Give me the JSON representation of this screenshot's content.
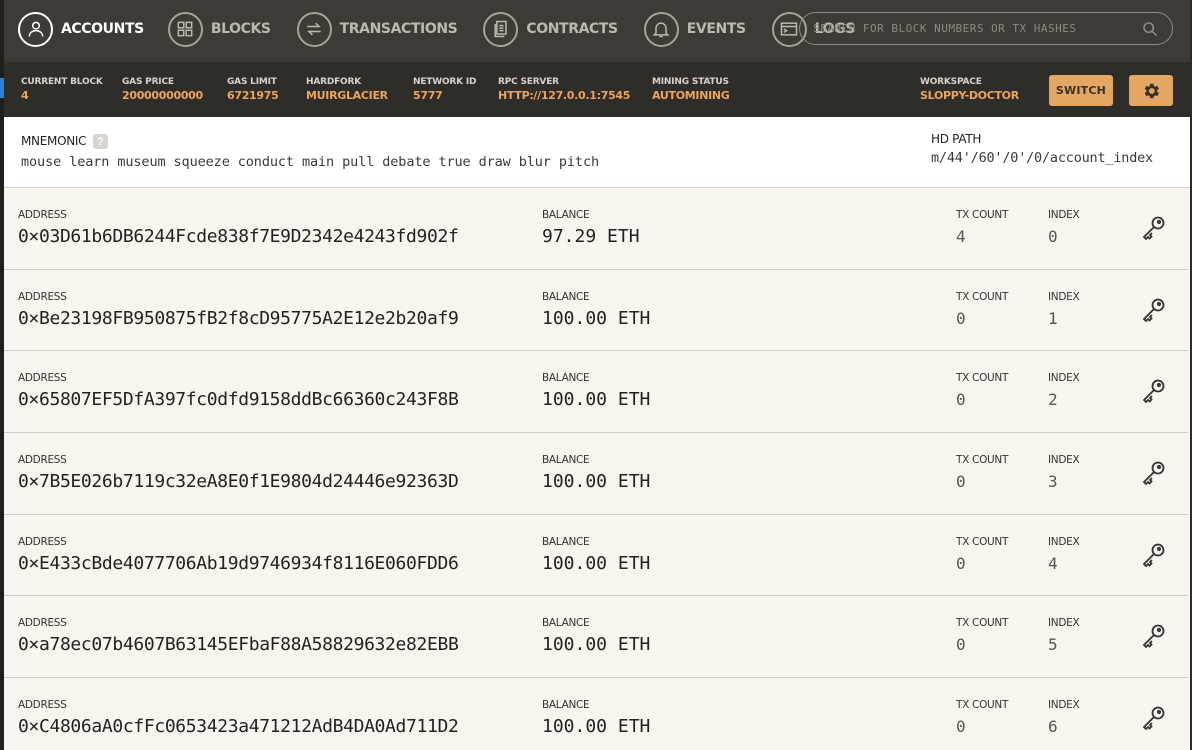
{
  "nav": {
    "items": [
      {
        "label": "ACCOUNTS",
        "icon": "account-icon",
        "active": true
      },
      {
        "label": "BLOCKS",
        "icon": "blocks-icon",
        "active": false
      },
      {
        "label": "TRANSACTIONS",
        "icon": "transactions-icon",
        "active": false
      },
      {
        "label": "CONTRACTS",
        "icon": "contracts-icon",
        "active": false
      },
      {
        "label": "EVENTS",
        "icon": "bell-icon",
        "active": false
      },
      {
        "label": "LOGS",
        "icon": "terminal-icon",
        "active": false
      }
    ],
    "search_placeholder": "SEARCH FOR BLOCK NUMBERS OR TX HASHES"
  },
  "status": {
    "current_block": {
      "label": "CURRENT BLOCK",
      "value": "4"
    },
    "gas_price": {
      "label": "GAS PRICE",
      "value": "20000000000"
    },
    "gas_limit": {
      "label": "GAS LIMIT",
      "value": "6721975"
    },
    "hardfork": {
      "label": "HARDFORK",
      "value": "MUIRGLACIER"
    },
    "network_id": {
      "label": "NETWORK ID",
      "value": "5777"
    },
    "rpc_server": {
      "label": "RPC SERVER",
      "value": "HTTP://127.0.0.1:7545"
    },
    "mining_status": {
      "label": "MINING STATUS",
      "value": "AUTOMINING"
    },
    "workspace": {
      "label": "WORKSPACE",
      "value": "SLOPPY-DOCTOR"
    },
    "switch_label": "SWITCH"
  },
  "mnemonic": {
    "title": "MNEMONIC",
    "help": "?",
    "words": "mouse learn museum squeeze conduct main pull debate true draw blur pitch",
    "hd_title": "HD PATH",
    "hd_path": "m/44'/60'/0'/0/account_index"
  },
  "labels": {
    "address": "ADDRESS",
    "balance": "BALANCE",
    "tx_count": "TX COUNT",
    "index": "INDEX"
  },
  "accounts": [
    {
      "address": "0×03D61b6DB6244Fcde838f7E9D2342e4243fd902f",
      "balance": "97.29 ETH",
      "tx_count": "4",
      "index": "0"
    },
    {
      "address": "0×Be23198FB950875fB2f8cD95775A2E12e2b20af9",
      "balance": "100.00 ETH",
      "tx_count": "0",
      "index": "1"
    },
    {
      "address": "0×65807EF5DfA397fc0dfd9158ddBc66360c243F8B",
      "balance": "100.00 ETH",
      "tx_count": "0",
      "index": "2"
    },
    {
      "address": "0×7B5E026b7119c32eA8E0f1E9804d24446e92363D",
      "balance": "100.00 ETH",
      "tx_count": "0",
      "index": "3"
    },
    {
      "address": "0×E433cBde4077706Ab19d9746934f8116E060FDD6",
      "balance": "100.00 ETH",
      "tx_count": "0",
      "index": "4"
    },
    {
      "address": "0×a78ec07b4607B63145EFbaF88A58829632e82EBB",
      "balance": "100.00 ETH",
      "tx_count": "0",
      "index": "5"
    },
    {
      "address": "0×C4806aA0cfFc0653423a471212AdB4DA0Ad711D2",
      "balance": "100.00 ETH",
      "tx_count": "0",
      "index": "6"
    }
  ],
  "colors": {
    "accent": "#e4a663",
    "status_value": "#eaa45f",
    "nav_bg": "#3e3b36",
    "status_bg": "#2f2d29"
  }
}
